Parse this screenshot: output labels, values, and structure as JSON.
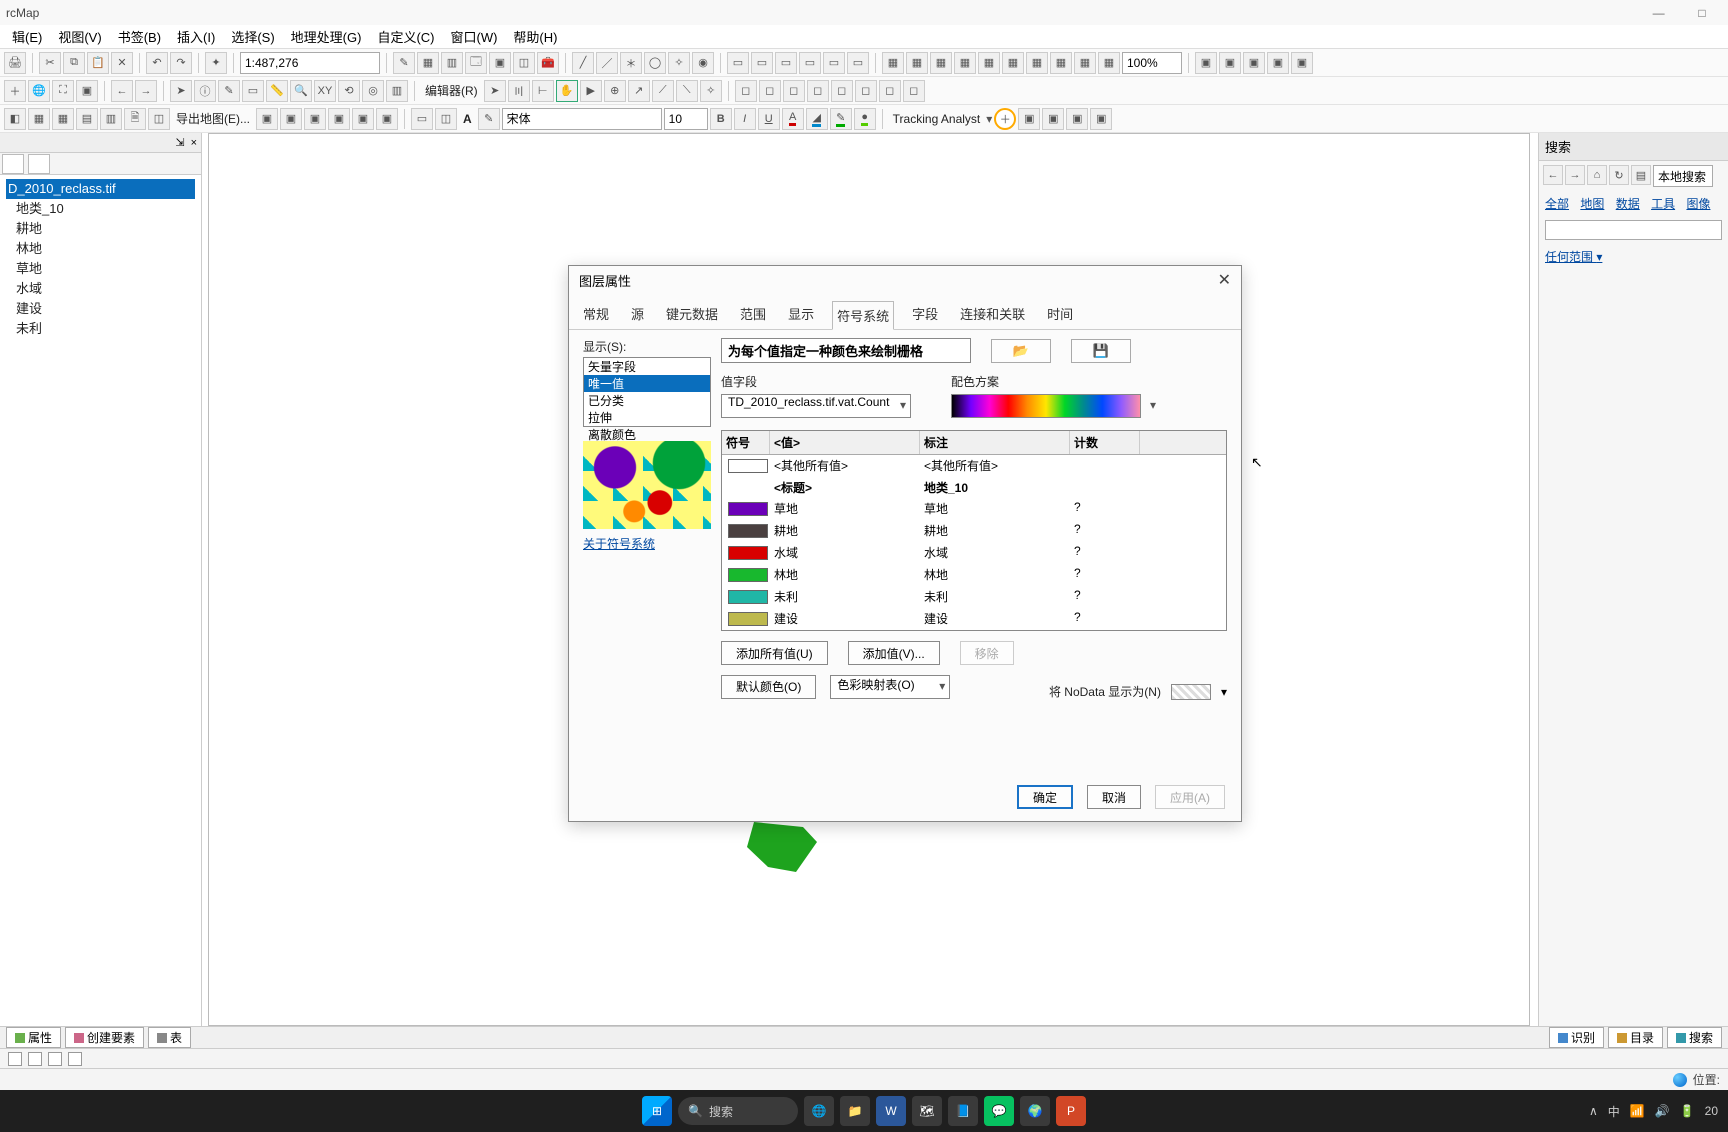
{
  "app_title": "rcMap",
  "win_buttons": {
    "min": "—",
    "max": "□"
  },
  "menu": [
    "辑(E)",
    "视图(V)",
    "书签(B)",
    "插入(I)",
    "选择(S)",
    "地理处理(G)",
    "自定义(C)",
    "窗口(W)",
    "帮助(H)"
  ],
  "scale_value": "1:487,276",
  "editor_label": "编辑器(R)",
  "font_name": "宋体",
  "font_size": "10",
  "zoom_pct": "100%",
  "tracking_label": "Tracking Analyst",
  "export_map": "导出地图(E)...",
  "left_pin": "⇲",
  "left_close": "×",
  "tree": {
    "layer": "D_2010_reclass.tif",
    "attr": "地类_10",
    "items": [
      "耕地",
      "林地",
      "草地",
      "水域",
      "建设",
      "未利"
    ]
  },
  "right": {
    "title": "搜索",
    "scope": "本地搜索",
    "links": [
      "全部",
      "地图",
      "数据",
      "工具",
      "图像"
    ],
    "any_range": "任何范围",
    "dropdown_arrow": "▾"
  },
  "dialog": {
    "title": "图层属性",
    "tabs": [
      "常规",
      "源",
      "键元数据",
      "范围",
      "显示",
      "符号系统",
      "字段",
      "连接和关联",
      "时间"
    ],
    "active_tab": "符号系统",
    "show_label": "显示(S):",
    "methods": [
      "矢量字段",
      "唯一值",
      "已分类",
      "拉伸",
      "离散颜色"
    ],
    "method_sel": "唯一值",
    "preview_link": "关于符号系统",
    "heading": "为每个值指定一种颜色来绘制栅格",
    "open_icon": "📂",
    "save_icon": "💾",
    "value_field_label": "值字段",
    "value_field": "TD_2010_reclass.tif.vat.Count",
    "scheme_label": "配色方案",
    "grid_hdr": {
      "sym": "符号",
      "val": "<值>",
      "lbl": "标注",
      "cnt": "计数"
    },
    "rows": [
      {
        "color": "outline",
        "val": "<其他所有值>",
        "lbl": "<其他所有值>",
        "cnt": ""
      },
      {
        "color": "",
        "val": "<标题>",
        "lbl": "地类_10",
        "cnt": "",
        "bold": true
      },
      {
        "color": "#6b00b8",
        "val": "草地",
        "lbl": "草地",
        "cnt": "?"
      },
      {
        "color": "#4a4040",
        "val": "耕地",
        "lbl": "耕地",
        "cnt": "?"
      },
      {
        "color": "#d80000",
        "val": "水域",
        "lbl": "水域",
        "cnt": "?"
      },
      {
        "color": "#18b82e",
        "val": "林地",
        "lbl": "林地",
        "cnt": "?"
      },
      {
        "color": "#20b7a6",
        "val": "未利",
        "lbl": "未利",
        "cnt": "?"
      },
      {
        "color": "#bdb94e",
        "val": "建设",
        "lbl": "建设",
        "cnt": "?"
      }
    ],
    "btn_add_all": "添加所有值(U)",
    "btn_add_val": "添加值(V)...",
    "btn_remove": "移除",
    "btn_default": "默认颜色(O)",
    "colormap_label": "色彩映射表(O)",
    "dropdown_arrow": "▾",
    "nodata_label": "将 NoData 显示为(N)",
    "ok": "确定",
    "cancel": "取消",
    "apply": "应用(A)"
  },
  "bottom_tabs": {
    "props": "属性",
    "create": "创建要素",
    "table": "表",
    "identify": "识别",
    "toc": "目录",
    "search": "搜索"
  },
  "status": {
    "pos_label": "位置:"
  },
  "taskbar": {
    "search": "搜索",
    "tray": {
      "ime": "中",
      "time": "20"
    },
    "arrow": "∧"
  }
}
